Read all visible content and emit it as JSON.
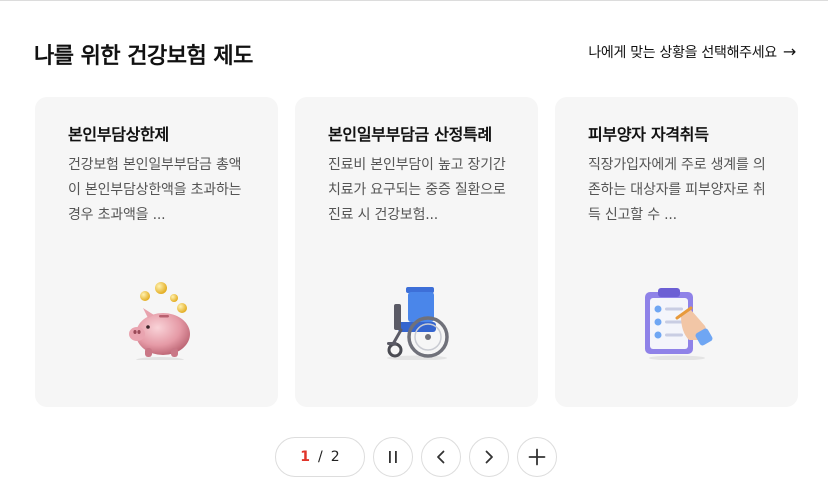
{
  "section": {
    "title": "나를 위한 건강보험 제도",
    "more_label": "나에게 맞는 상황을 선택해주세요",
    "more_arrow": "→"
  },
  "cards": [
    {
      "title": "본인부담상한제",
      "desc": "건강보험 본인일부부담금 총액이 본인부담상한액을 초과하는 경우 초과액을 ...",
      "icon": "piggy-bank-icon"
    },
    {
      "title": "본인일부부담금 산정특례",
      "desc": "진료비 본인부담이 높고 장기간 치료가 요구되는 중증 질환으로 진료 시 건강보험...",
      "icon": "wheelchair-icon"
    },
    {
      "title": "피부양자 자격취득",
      "desc": "직장가입자에게 주로 생계를 의존하는 대상자를 피부양자로 취득 신고할 수 ...",
      "icon": "clipboard-checklist-icon"
    }
  ],
  "pager": {
    "current": "1",
    "separator": "/",
    "total": "2"
  },
  "colors": {
    "accent": "#e0352b",
    "card_bg": "#f6f6f6"
  }
}
